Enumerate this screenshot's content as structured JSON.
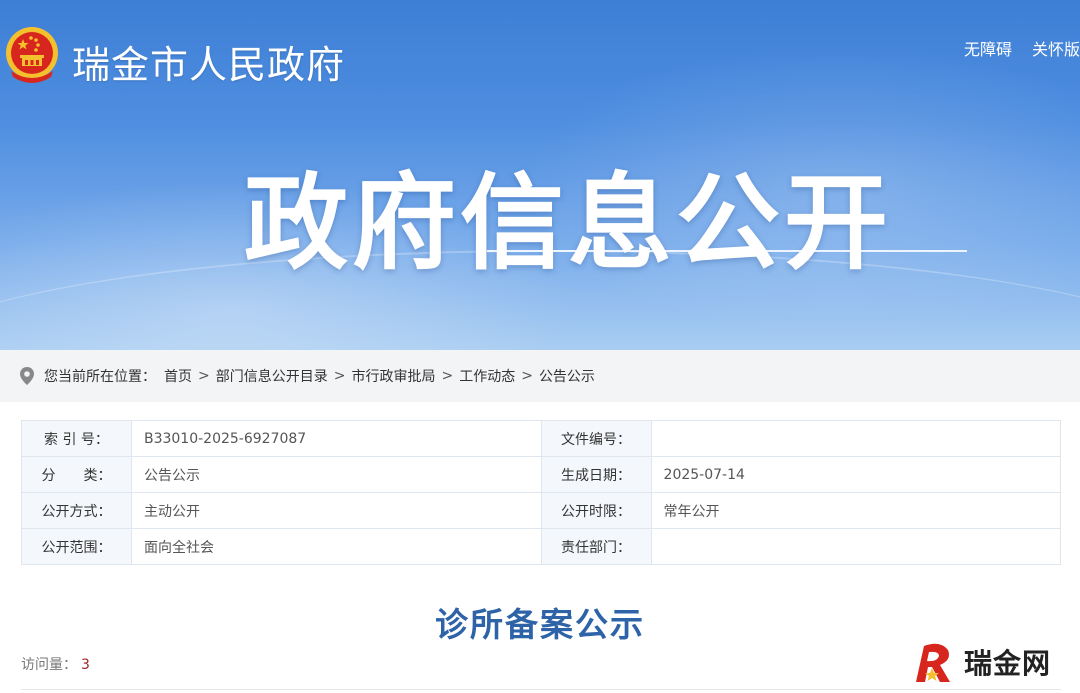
{
  "header": {
    "site_title": "瑞金市人民政府",
    "links": [
      "无障碍",
      "关怀版"
    ]
  },
  "banner": {
    "title": "政府信息公开"
  },
  "breadcrumb": {
    "prefix": "您当前所在位置：",
    "items": [
      "首页",
      "部门信息公开目录",
      "市行政审批局",
      "工作动态",
      "公告公示"
    ],
    "separator": ">"
  },
  "meta": {
    "rows": [
      {
        "label1": "索 引 号：",
        "value1": "B33010-2025-6927087",
        "label2": "文件编号：",
        "value2": ""
      },
      {
        "label1": "分　　类：",
        "value1": "公告公示",
        "label2": "生成日期：",
        "value2": "2025-07-14"
      },
      {
        "label1": "公开方式：",
        "value1": "主动公开",
        "label2": "公开时限：",
        "value2": "常年公开"
      },
      {
        "label1": "公开范围：",
        "value1": "面向全社会",
        "label2": "责任部门：",
        "value2": ""
      }
    ]
  },
  "document": {
    "title": "诊所备案公示",
    "visits_label": "访问量：",
    "visits_count": "3"
  },
  "watermark": {
    "text": "瑞金网"
  },
  "colors": {
    "banner_top": "#3d7fd6",
    "banner_bottom": "#a9cdf2",
    "doc_title": "#2e63a8",
    "visit_count": "#a0282a",
    "emblem_red": "#d7261e",
    "emblem_gold": "#f5c02e"
  }
}
